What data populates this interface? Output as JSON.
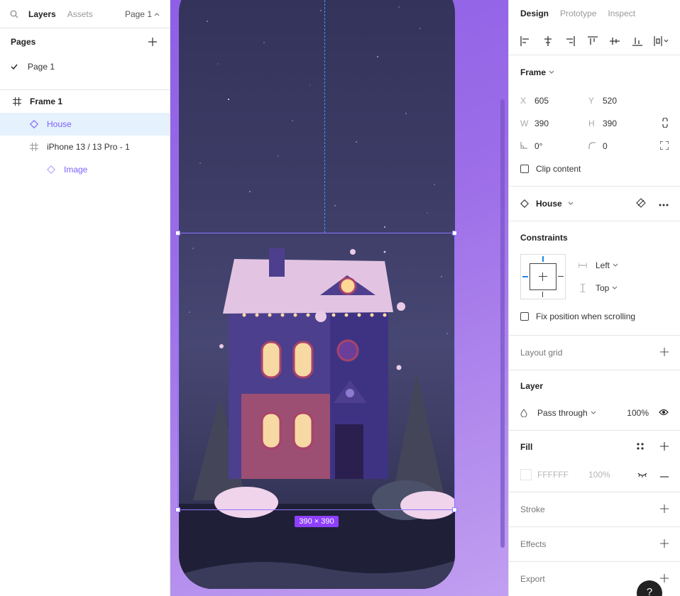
{
  "left_panel": {
    "tabs": [
      "Layers",
      "Assets"
    ],
    "page_selector": "Page 1",
    "pages_title": "Pages",
    "pages": [
      "Page 1"
    ],
    "layers": [
      {
        "label": "Frame 1",
        "type": "frame"
      },
      {
        "label": "House",
        "type": "component"
      },
      {
        "label": "iPhone 13 / 13 Pro - 1",
        "type": "frame"
      },
      {
        "label": "Image",
        "type": "component"
      }
    ]
  },
  "canvas": {
    "dimension_badge": "390 × 390"
  },
  "right_panel": {
    "tabs": [
      "Design",
      "Prototype",
      "Inspect"
    ],
    "frame": {
      "title": "Frame",
      "x_label": "X",
      "x": "605",
      "y_label": "Y",
      "y": "520",
      "w_label": "W",
      "w": "390",
      "h_label": "H",
      "h": "390",
      "rotation": "0°",
      "radius": "0",
      "clip_content": "Clip content"
    },
    "component": {
      "name": "House"
    },
    "constraints": {
      "title": "Constraints",
      "horizontal": "Left",
      "vertical": "Top",
      "fix_position": "Fix position when scrolling"
    },
    "layout_grid": "Layout grid",
    "layer": {
      "title": "Layer",
      "blend": "Pass through",
      "opacity": "100%"
    },
    "fill": {
      "title": "Fill",
      "hex": "FFFFFF",
      "opacity": "100%"
    },
    "stroke": "Stroke",
    "effects": "Effects",
    "export": "Export",
    "help": "?"
  },
  "colors": {
    "accent": "#7b61ff",
    "selection": "#e5f1fc",
    "badge": "#8e3fff",
    "canvas": "#9d6ee8"
  }
}
